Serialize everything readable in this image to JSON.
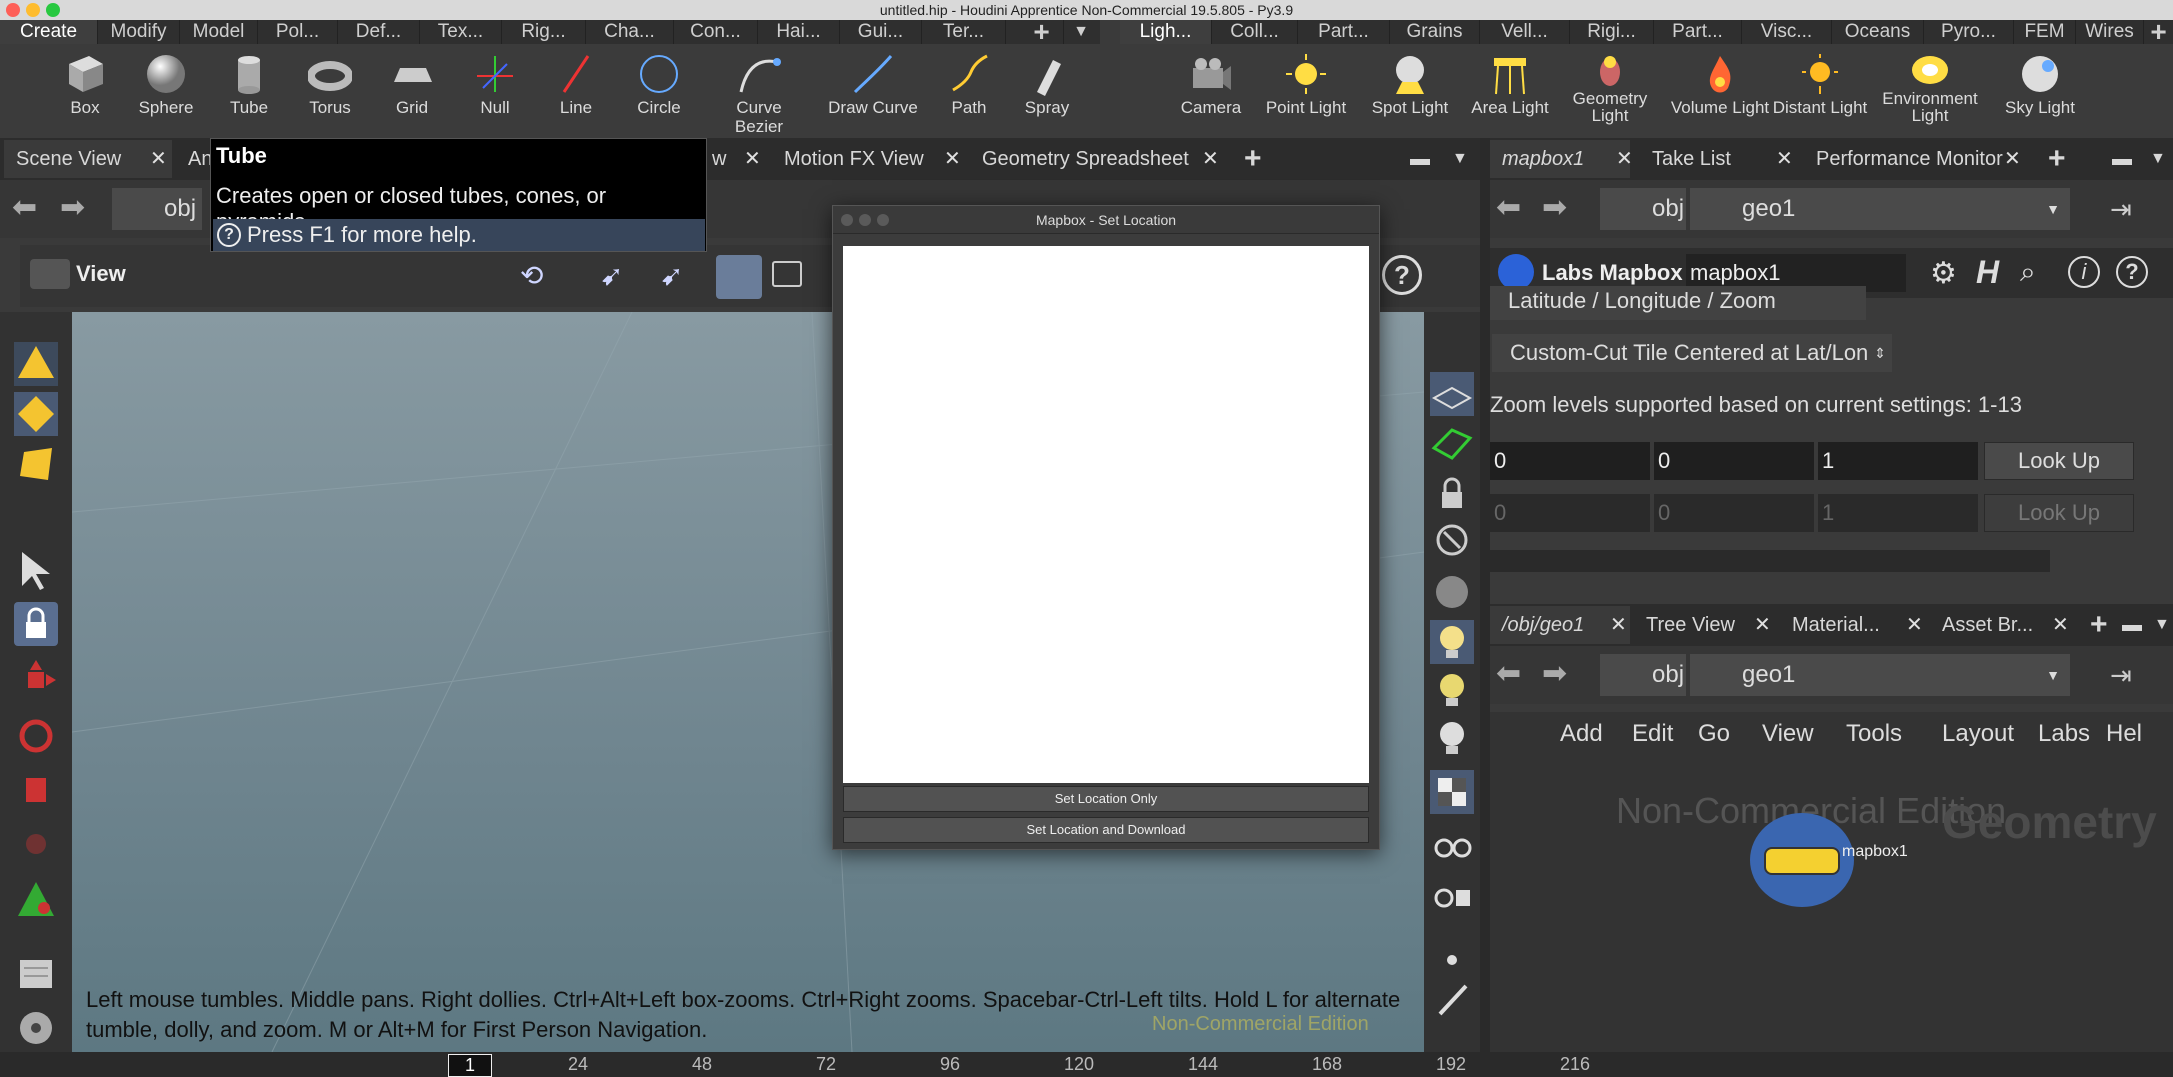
{
  "window": {
    "title": "untitled.hip - Houdini Apprentice Non-Commercial 19.5.805 - Py3.9"
  },
  "shelf_tabs_left": [
    "Create",
    "Modify",
    "Model",
    "Pol...",
    "Def...",
    "Tex...",
    "Rig...",
    "Cha...",
    "Con...",
    "Hai...",
    "Gui...",
    "Ter..."
  ],
  "shelf_tabs_right": [
    "Ligh...",
    "Coll...",
    "Part...",
    "Grains",
    "Vell...",
    "Rigi...",
    "Part...",
    "Visc...",
    "Oceans",
    "Pyro...",
    "FEM",
    "Wires"
  ],
  "shelf_tools_left": [
    "Box",
    "Sphere",
    "Tube",
    "Torus",
    "Grid",
    "Null",
    "Line",
    "Circle",
    "Curve Bezier",
    "Draw Curve",
    "Path",
    "Spray"
  ],
  "shelf_tools_right": [
    "Camera",
    "Point Light",
    "Spot Light",
    "Area Light",
    "Geometry Light",
    "Volume Light",
    "Distant Light",
    "Environment Light",
    "Sky Light"
  ],
  "pane_tabs_left": [
    "Scene View",
    "An",
    "w",
    "Motion FX View",
    "Geometry Spreadsheet"
  ],
  "pane_tabs_right": [
    "mapbox1",
    "Take List",
    "Performance Monitor"
  ],
  "tooltip": {
    "title": "Tube",
    "description": "Creates open or closed tubes, cones, or pyramids.",
    "help": "Press F1 for more help."
  },
  "pathbar": {
    "context": "obj",
    "node": "geo1"
  },
  "viewport": {
    "label": "View",
    "hud_line1": "Left mouse tumbles. Middle pans. Right dollies. Ctrl+Alt+Left box-zooms. Ctrl+Right zooms. Spacebar-Ctrl-Left tilts. Hold L for alternate",
    "hud_line2": "tumble, dolly, and zoom.     M or Alt+M for First Person Navigation.",
    "watermark": "Non-Commercial Edition"
  },
  "dialog": {
    "title": "Mapbox - Set Location",
    "btn1": "Set Location Only",
    "btn2": "Set Location and Download"
  },
  "params": {
    "node_type": "Labs Mapbox",
    "node_name": "mapbox1",
    "mode": "Latitude / Longitude / Zoom",
    "tile": "Custom-Cut Tile Centered at Lat/Lon",
    "zoom_note": "Zoom levels supported based on current settings: 1-13",
    "row1": [
      "0",
      "0",
      "1"
    ],
    "row2": [
      "0",
      "0",
      "1"
    ],
    "lookup": "Look Up"
  },
  "pane2_tabs": [
    "/obj/geo1",
    "Tree View",
    "Material...",
    "Asset Br..."
  ],
  "net_menu": [
    "Add",
    "Edit",
    "Go",
    "View",
    "Tools",
    "Layout",
    "Labs",
    "Hel"
  ],
  "network": {
    "watermark": "Non-Commercial Edition",
    "context": "Geometry",
    "node_label": "mapbox1"
  },
  "timeline": [
    "1",
    "24",
    "48",
    "72",
    "96",
    "120",
    "144",
    "168",
    "192",
    "216"
  ]
}
